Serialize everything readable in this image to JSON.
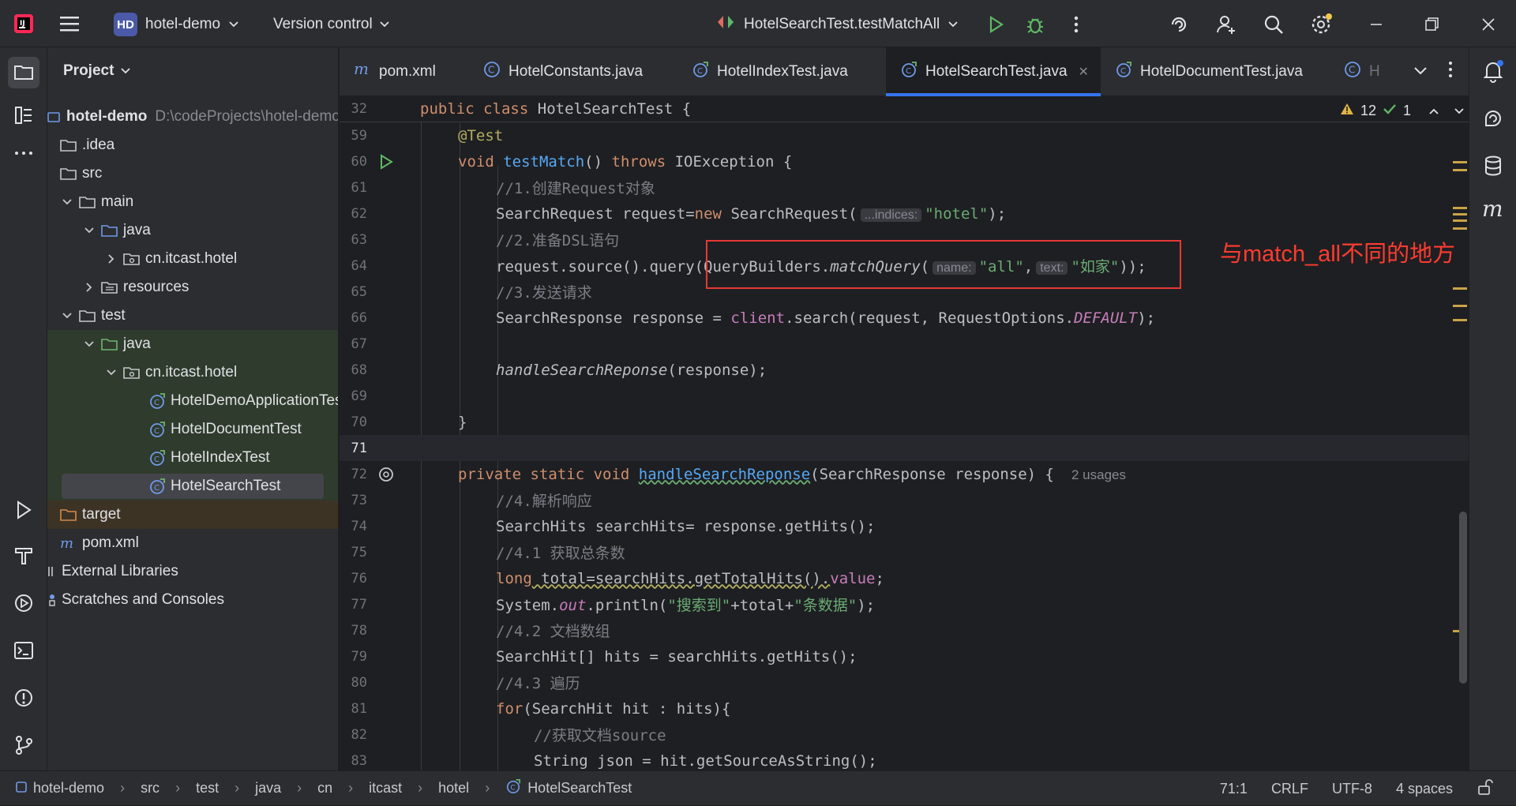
{
  "titlebar": {
    "project_badge": "HD",
    "project_name": "hotel-demo",
    "vcs": "Version control",
    "run_config": "HotelSearchTest.testMatchAll"
  },
  "project_panel": {
    "title": "Project",
    "root_name": "hotel-demo",
    "root_path": "D:\\codeProjects\\hotel-demo",
    "items": [
      {
        "label": ".idea"
      },
      {
        "label": "src"
      },
      {
        "label": "main"
      },
      {
        "label": "java"
      },
      {
        "label": "cn.itcast.hotel"
      },
      {
        "label": "resources"
      },
      {
        "label": "test"
      },
      {
        "label": "java"
      },
      {
        "label": "cn.itcast.hotel"
      },
      {
        "label": "HotelDemoApplicationTests"
      },
      {
        "label": "HotelDocumentTest"
      },
      {
        "label": "HotelIndexTest"
      },
      {
        "label": "HotelSearchTest"
      },
      {
        "label": "target"
      },
      {
        "label": "pom.xml"
      },
      {
        "label": "External Libraries"
      },
      {
        "label": "Scratches and Consoles"
      }
    ]
  },
  "tabs": [
    {
      "label": "pom.xml"
    },
    {
      "label": "HotelConstants.java"
    },
    {
      "label": "HotelIndexTest.java"
    },
    {
      "label": "HotelSearchTest.java"
    },
    {
      "label": "HotelDocumentTest.java"
    },
    {
      "label": "H"
    }
  ],
  "inspections": {
    "warnings": "12",
    "ok": "1"
  },
  "editor": {
    "ln": [
      "32",
      "59",
      "60",
      "61",
      "62",
      "63",
      "64",
      "65",
      "66",
      "67",
      "68",
      "69",
      "70",
      "71",
      "72",
      "73",
      "74",
      "75",
      "76",
      "77",
      "78",
      "79",
      "80",
      "81",
      "82",
      "83"
    ],
    "l32": {
      "kw1": "public",
      "kw2": "class",
      "name": "HotelSearchTest {"
    },
    "l59": "@Test",
    "l60": {
      "kw": "void",
      "fn": "testMatch",
      "rest1": "() ",
      "kw2": "throws",
      "rest2": " IOException {"
    },
    "l61": "//1.创建Request对象",
    "l62": {
      "a": "SearchRequest request=",
      "kw": "new",
      "b": " SearchRequest(",
      "hint": "...indices:",
      "str": "\"hotel\"",
      "c": ");"
    },
    "l63": "//2.准备DSL语句",
    "l64": {
      "a": "request.source().query(QueryBuilders.",
      "m": "matchQuery",
      "b": "(",
      "h1": "name:",
      "s1": "\"all\"",
      "c": ",",
      "h2": "text:",
      "s2": "\"如家\"",
      "d": "));"
    },
    "l65": "//3.发送请求",
    "l66": {
      "a": "SearchResponse response = ",
      "f": "client",
      "b": ".search(request, RequestOptions.",
      "d": "DEFAULT",
      "c": ");"
    },
    "l68": {
      "m": "handleSearchReponse",
      "b": "(response);"
    },
    "l70": "}",
    "l72": {
      "kw": "private static void",
      "fn": "handleSearchReponse",
      "b": "(SearchResponse response) {",
      "usages": "2 usages"
    },
    "l73": "//4.解析响应",
    "l74": "SearchHits searchHits= response.getHits();",
    "l75": "//4.1 获取总条数",
    "l76": {
      "kw": "long",
      "a": " total=searchHits.getTotalHits().",
      "f": "value",
      "b": ";"
    },
    "l77": {
      "a": "System.",
      "o": "out",
      "b": ".println(",
      "s1": "\"搜索到\"",
      "c": "+total+",
      "s2": "\"条数据\"",
      "d": ");"
    },
    "l78": "//4.2 文档数组",
    "l79": "SearchHit[] hits = searchHits.getHits();",
    "l80": "//4.3 遍历",
    "l81": {
      "kw": "for",
      "b": "(SearchHit hit : hits){"
    },
    "l82": "//获取文档source",
    "l83": "String json = hit.getSourceAsString();"
  },
  "annotation": "与match_all不同的地方",
  "statusbar": {
    "crumbs": [
      "hotel-demo",
      "src",
      "test",
      "java",
      "cn",
      "itcast",
      "hotel",
      "HotelSearchTest"
    ],
    "position": "71:1",
    "line_sep": "CRLF",
    "encoding": "UTF-8",
    "indent": "4 spaces"
  },
  "colors": {
    "accent": "#3574f0",
    "annotation": "#ff3b30"
  }
}
